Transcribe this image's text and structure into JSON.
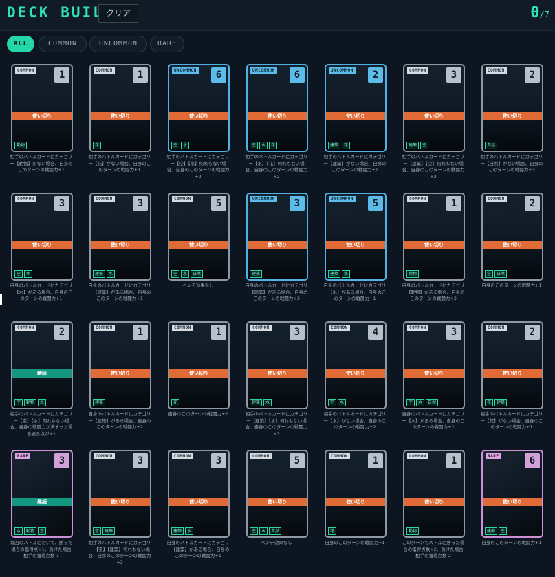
{
  "header": {
    "title": "DECK BUILD",
    "clear_label": "クリア",
    "count_current": "0",
    "count_max": "/7"
  },
  "filters": [
    "ALL",
    "COMMON",
    "UNCOMMON",
    "RARE"
  ],
  "colors": {
    "accent": "#2ee2b6",
    "common_border": "#8d98a4",
    "uncommon_border": "#52b0e3",
    "rare_border": "#cc90d6",
    "use_once_band": "#e06b37",
    "continuous_band": "#159881"
  },
  "cards": [
    {
      "rarity": "COMMON",
      "cost": "1",
      "timing": "使い切り",
      "tags": [
        "動物"
      ],
      "desc": "相手のバトルカードにカテゴリー【動物】がない場合、自身のこのターンの戦闘力+1"
    },
    {
      "rarity": "COMMON",
      "cost": "1",
      "timing": "使い切り",
      "tags": [
        "花"
      ],
      "desc": "相手のバトルカードにカテゴリー【花】がない場合、自身のこのターンの戦闘力+1"
    },
    {
      "rarity": "UNCOMMON",
      "cost": "6",
      "timing": "使い切り",
      "tags": [
        "空",
        "水"
      ],
      "desc": "相手のバトルカードにカテゴリー【空】【水】何れもない場合、自身のこのターンの戦闘力+2"
    },
    {
      "rarity": "UNCOMMON",
      "cost": "6",
      "timing": "使い切り",
      "tags": [
        "空",
        "水",
        "花"
      ],
      "desc": "相手のバトルカードにカテゴリー【水】【花】何れもない場合、自身のこのターンの戦闘力+2"
    },
    {
      "rarity": "UNCOMMON",
      "cost": "2",
      "timing": "使い切り",
      "tags": [
        "建築",
        "花"
      ],
      "desc": "相手のバトルカードにカテゴリー【建築】がない場合、自身のこのターンの戦闘力+1"
    },
    {
      "rarity": "COMMON",
      "cost": "3",
      "timing": "使い切り",
      "tags": [
        "建築",
        "空"
      ],
      "desc": "相手のバトルカードにカテゴリー【建築】【空】何れもない場合、自身のこのターンの戦闘力+2"
    },
    {
      "rarity": "COMMON",
      "cost": "2",
      "timing": "使い切り",
      "tags": [
        "自然"
      ],
      "desc": "相手のバトルカードにカテゴリー【自然】がない場合、自身のこのターンの戦闘力+3"
    },
    {
      "rarity": "COMMON",
      "cost": "3",
      "timing": "使い切り",
      "tags": [
        "空",
        "水"
      ],
      "desc": "自身のバトルカードにカテゴリー【水】がある場合、自身のこのターンの戦闘力+1"
    },
    {
      "rarity": "COMMON",
      "cost": "3",
      "timing": "使い切り",
      "tags": [
        "建築",
        "水"
      ],
      "desc": "自身のバトルカードにカテゴリー【建築】がある場合、自身のこのターンの戦闘力+1"
    },
    {
      "rarity": "COMMON",
      "cost": "5",
      "timing": "使い切り",
      "tags": [
        "空",
        "水",
        "自然"
      ],
      "desc": "ベンチ効果なし"
    },
    {
      "rarity": "UNCOMMON",
      "cost": "3",
      "timing": "使い切り",
      "tags": [
        "建築"
      ],
      "desc": "自身のバトルカードにカテゴリー【建築】がある場合、自身のこのターンの戦闘力+3"
    },
    {
      "rarity": "UNCOMMON",
      "cost": "5",
      "timing": "使い切り",
      "tags": [
        "建築",
        "水"
      ],
      "desc": "自身のバトルカードにカテゴリー【水】がある場合、自身のこのターンの戦闘力+1"
    },
    {
      "rarity": "COMMON",
      "cost": "1",
      "timing": "使い切り",
      "tags": [
        "動物"
      ],
      "desc": "自身のバトルカードにカテゴリー【動物】がある場合、自身のこのターンの戦闘力+3"
    },
    {
      "rarity": "COMMON",
      "cost": "2",
      "timing": "使い切り",
      "tags": [
        "空",
        "自然"
      ],
      "desc": "自身のこのターンの戦闘力+1"
    },
    {
      "rarity": "COMMON",
      "cost": "2",
      "timing": "継続",
      "tags": [
        "空",
        "動物",
        "水"
      ],
      "desc": "相手のバトルカードにカテゴリー【空】【水】何れもない場合、自身の戦闘力が決まった場合被る点が+1"
    },
    {
      "rarity": "COMMON",
      "cost": "1",
      "timing": "使い切り",
      "tags": [
        "建築"
      ],
      "desc": "自身のバトルカードにカテゴリー【建築】がある場合、自身のこのターンの戦闘力+2"
    },
    {
      "rarity": "COMMON",
      "cost": "1",
      "timing": "使い切り",
      "tags": [
        "花"
      ],
      "desc": "自身のこのターンの戦闘力+2"
    },
    {
      "rarity": "COMMON",
      "cost": "3",
      "timing": "使い切り",
      "tags": [
        "建築",
        "水"
      ],
      "desc": "相手のバトルカードにカテゴリー【建築】【水】何れもない場合、自身のこのターンの戦闘力+3"
    },
    {
      "rarity": "COMMON",
      "cost": "4",
      "timing": "使い切り",
      "tags": [
        "空",
        "水"
      ],
      "desc": "相手のバトルカードにカテゴリー【水】がない場合、自身のこのターンの戦闘力+2"
    },
    {
      "rarity": "COMMON",
      "cost": "3",
      "timing": "使い切り",
      "tags": [
        "空",
        "水",
        "自然"
      ],
      "desc": "自身のバトルカードにカテゴリー【水】がある場合、自身のこのターンの戦闘力+2"
    },
    {
      "rarity": "COMMON",
      "cost": "2",
      "timing": "使い切り",
      "tags": [
        "花",
        "建築"
      ],
      "desc": "相手のバトルカードにカテゴリー【花】がない場合、自身のこのターンの戦闘力+1"
    },
    {
      "rarity": "RARE",
      "cost": "3",
      "timing": "継続",
      "tags": [
        "水",
        "動物",
        "空"
      ],
      "desc": "毎回のバトルにおいて、勝った場合の獲得点+1。負けた場合相手の獲得点数-1"
    },
    {
      "rarity": "COMMON",
      "cost": "3",
      "timing": "使い切り",
      "tags": [
        "空",
        "建築"
      ],
      "desc": "相手のバトルカードにカテゴリー【空】【建築】何れもない場合、自身のこのターンの戦闘力+3"
    },
    {
      "rarity": "COMMON",
      "cost": "3",
      "timing": "使い切り",
      "tags": [
        "建築",
        "水"
      ],
      "desc": "自身のバトルカードにカテゴリー【建築】がある場合、自身のこのターンの戦闘力+1"
    },
    {
      "rarity": "COMMON",
      "cost": "5",
      "timing": "使い切り",
      "tags": [
        "空",
        "水",
        "自然"
      ],
      "desc": "ベンチ効果なし"
    },
    {
      "rarity": "COMMON",
      "cost": "1",
      "timing": "使い切り",
      "tags": [
        "花"
      ],
      "desc": "自身のこのターンの戦闘力+1"
    },
    {
      "rarity": "COMMON",
      "cost": "1",
      "timing": "使い切り",
      "tags": [
        "動物"
      ],
      "desc": "このターンでバトルに勝った場合の獲得点数+2。負けた場合相手の獲得点数-2"
    },
    {
      "rarity": "RARE",
      "cost": "6",
      "timing": "使い切り",
      "tags": [
        "建築",
        "空"
      ],
      "desc": "自身のこのターンの戦闘力+1"
    }
  ]
}
